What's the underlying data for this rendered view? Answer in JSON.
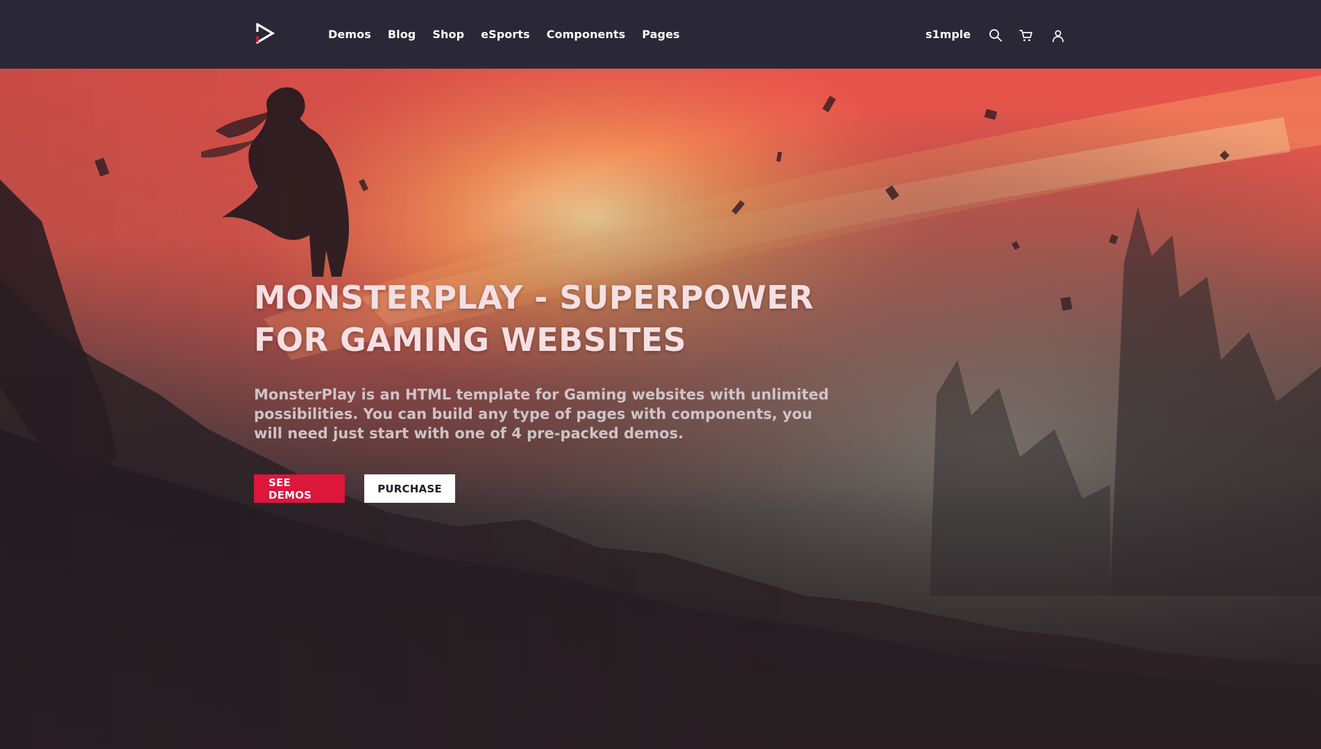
{
  "navbar": {
    "logo_icon": "play-arrow-logo-icon",
    "menu": [
      {
        "label": "Demos"
      },
      {
        "label": "Blog"
      },
      {
        "label": "Shop"
      },
      {
        "label": "eSports"
      },
      {
        "label": "Components"
      },
      {
        "label": "Pages"
      }
    ],
    "username": "s1mple",
    "icons": [
      "search-icon",
      "cart-icon",
      "user-icon"
    ]
  },
  "hero": {
    "title": "MONSTERPLAY - SUPERPOWER FOR GAMING WEBSITES",
    "description": "MonsterPlay is an HTML template for Gaming websites with unlimited possibilities. You can build any type of pages with components, you will need just start with one of 4 pre-packed demos.",
    "buttons": {
      "primary": "SEE DEMOS",
      "secondary": "PURCHASE"
    }
  },
  "colors": {
    "navbar_bg": "#2a2837",
    "accent": "#dd163b",
    "title_text": "#f6dfe2"
  }
}
